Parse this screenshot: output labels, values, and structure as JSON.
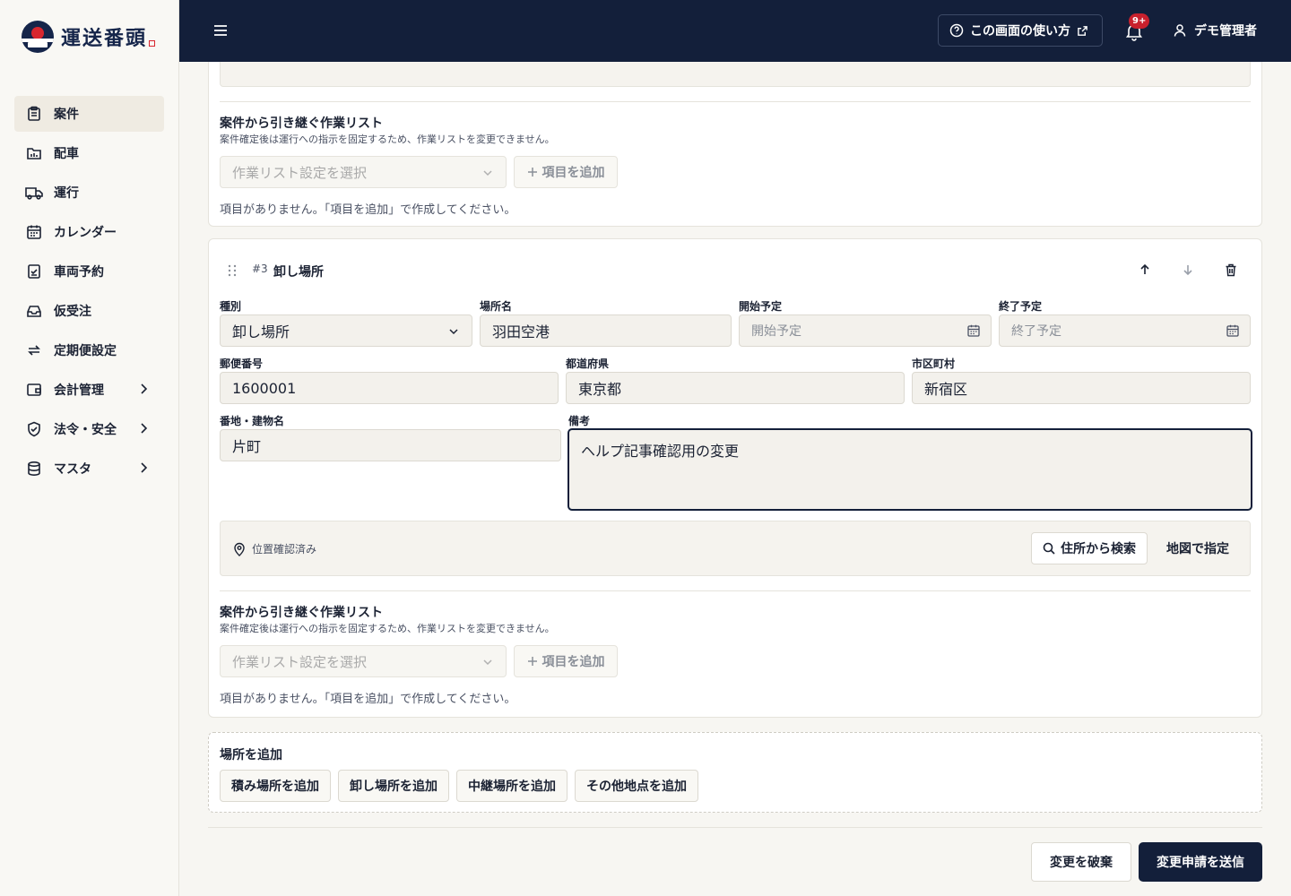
{
  "app": {
    "logo_text": "運送番頭"
  },
  "sidebar": {
    "items": [
      {
        "label": "案件",
        "icon": "clipboard-icon",
        "active": true
      },
      {
        "label": "配車",
        "icon": "calendar-board-icon"
      },
      {
        "label": "運行",
        "icon": "truck-icon"
      },
      {
        "label": "カレンダー",
        "icon": "calendar-icon"
      },
      {
        "label": "車両予約",
        "icon": "checklist-icon"
      },
      {
        "label": "仮受注",
        "icon": "inbox-icon"
      },
      {
        "label": "定期便設定",
        "icon": "repeat-icon"
      },
      {
        "label": "会計管理",
        "icon": "wallet-icon",
        "expandable": true
      },
      {
        "label": "法令・安全",
        "icon": "shield-icon",
        "expandable": true
      },
      {
        "label": "マスタ",
        "icon": "database-icon",
        "expandable": true
      }
    ]
  },
  "header": {
    "help_label": "この画面の使い方",
    "notification_badge": "9+",
    "user_name": "デモ管理者"
  },
  "top_partial": {
    "task_title": "案件から引き継ぐ作業リスト",
    "task_sub": "案件確定後は運行への指示を固定するため、作業リストを変更できません。",
    "task_select_placeholder": "作業リスト設定を選択",
    "task_add_label": "項目を追加",
    "task_empty": "項目がありません。「項目を追加」で作成してください。"
  },
  "stop3": {
    "number": "#3",
    "title": "卸し場所",
    "fields": {
      "type_label": "種別",
      "type_value": "卸し場所",
      "name_label": "場所名",
      "name_value": "羽田空港",
      "start_label": "開始予定",
      "start_placeholder": "開始予定",
      "end_label": "終了予定",
      "end_placeholder": "終了予定",
      "zip_label": "郵便番号",
      "zip_value": "1600001",
      "pref_label": "都道府県",
      "pref_value": "東京都",
      "city_label": "市区町村",
      "city_value": "新宿区",
      "addr_label": "番地・建物名",
      "addr_value": "片町",
      "note_label": "備考",
      "note_value": "ヘルプ記事確認用の変更"
    },
    "location_status": "位置確認済み",
    "search_address_label": "住所から検索",
    "map_label": "地図で指定",
    "task_title": "案件から引き継ぐ作業リスト",
    "task_sub": "案件確定後は運行への指示を固定するため、作業リストを変更できません。",
    "task_select_placeholder": "作業リスト設定を選択",
    "task_add_label": "項目を追加",
    "task_empty": "項目がありません。「項目を追加」で作成してください。"
  },
  "add_location": {
    "title": "場所を追加",
    "buttons": [
      "積み場所を追加",
      "卸し場所を追加",
      "中継場所を追加",
      "その他地点を追加"
    ]
  },
  "footer": {
    "discard_label": "変更を破棄",
    "submit_label": "変更申請を送信"
  }
}
